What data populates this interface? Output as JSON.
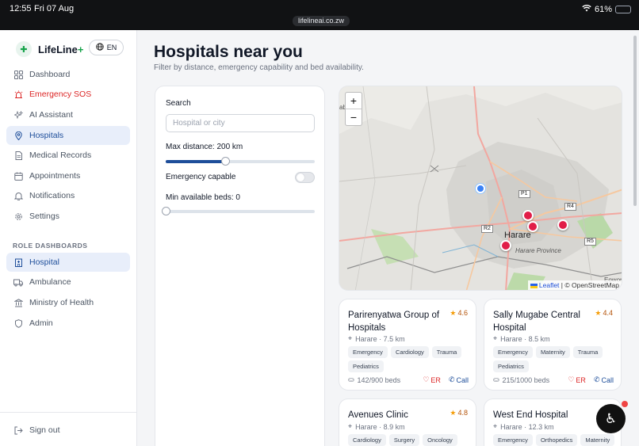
{
  "status": {
    "time": "12:55",
    "date": "Fri 07 Aug",
    "url": "lifelineai.co.zw",
    "battery": "61%"
  },
  "brand": {
    "name": "LifeLine",
    "plus": "+",
    "logo_text": "LifeLine",
    "lang": "EN"
  },
  "nav": [
    {
      "label": "Dashboard",
      "icon": "grid-icon"
    },
    {
      "label": "Emergency SOS",
      "icon": "siren-icon"
    },
    {
      "label": "AI Assistant",
      "icon": "sparkle-icon"
    },
    {
      "label": "Hospitals",
      "icon": "map-pin-icon"
    },
    {
      "label": "Medical Records",
      "icon": "file-icon"
    },
    {
      "label": "Appointments",
      "icon": "calendar-icon"
    },
    {
      "label": "Notifications",
      "icon": "bell-icon"
    },
    {
      "label": "Settings",
      "icon": "gear-icon"
    }
  ],
  "role_section": "ROLE DASHBOARDS",
  "roles": [
    {
      "label": "Hospital",
      "icon": "building-icon"
    },
    {
      "label": "Ambulance",
      "icon": "truck-icon"
    },
    {
      "label": "Ministry of Health",
      "icon": "landmark-icon"
    },
    {
      "label": "Admin",
      "icon": "shield-icon"
    }
  ],
  "signout": "Sign out",
  "page": {
    "title": "Hospitals near you",
    "subtitle": "Filter by distance, emergency capability and bed availability."
  },
  "filters": {
    "search_label": "Search",
    "search_placeholder": "Hospital or city",
    "distance_label": "Max distance: 200 km",
    "distance_fraction": 0.4,
    "emergency_label": "Emergency capable",
    "emergency_on": false,
    "beds_label": "Min available beds: 0",
    "beds_fraction": 0
  },
  "map": {
    "zoom_in": "+",
    "zoom_out": "−",
    "city": "Harare",
    "province": "Harare Province",
    "roads": [
      "P1",
      "R4",
      "R2",
      "R5"
    ],
    "edge_labels": [
      "ab",
      "Eowor"
    ],
    "attribution_leaflet": "Leaflet",
    "attribution_osm": "© OpenStreetMap"
  },
  "hospitals": [
    {
      "name": "Parirenyatwa Group of Hospitals",
      "rating": "4.6",
      "location": "Harare · 7.5 km",
      "tags": [
        "Emergency",
        "Cardiology",
        "Trauma",
        "Pediatrics"
      ],
      "beds": "142/900 beds",
      "er": "ER",
      "call": "Call"
    },
    {
      "name": "Sally Mugabe Central Hospital",
      "rating": "4.4",
      "location": "Harare · 8.5 km",
      "tags": [
        "Emergency",
        "Maternity",
        "Trauma",
        "Pediatrics"
      ],
      "beds": "215/1000 beds",
      "er": "ER",
      "call": "Call"
    },
    {
      "name": "Avenues Clinic",
      "rating": "4.8",
      "location": "Harare · 8.9 km",
      "tags": [
        "Cardiology",
        "Surgery",
        "Oncology"
      ]
    },
    {
      "name": "West End Hospital",
      "location": "Harare · 12.3 km",
      "tags": [
        "Emergency",
        "Orthopedics",
        "Maternity"
      ]
    }
  ],
  "colors": {
    "accent": "#1e4e9a",
    "danger": "#dc2626",
    "active_bg": "#e8eefa",
    "star": "#f59e0b"
  }
}
